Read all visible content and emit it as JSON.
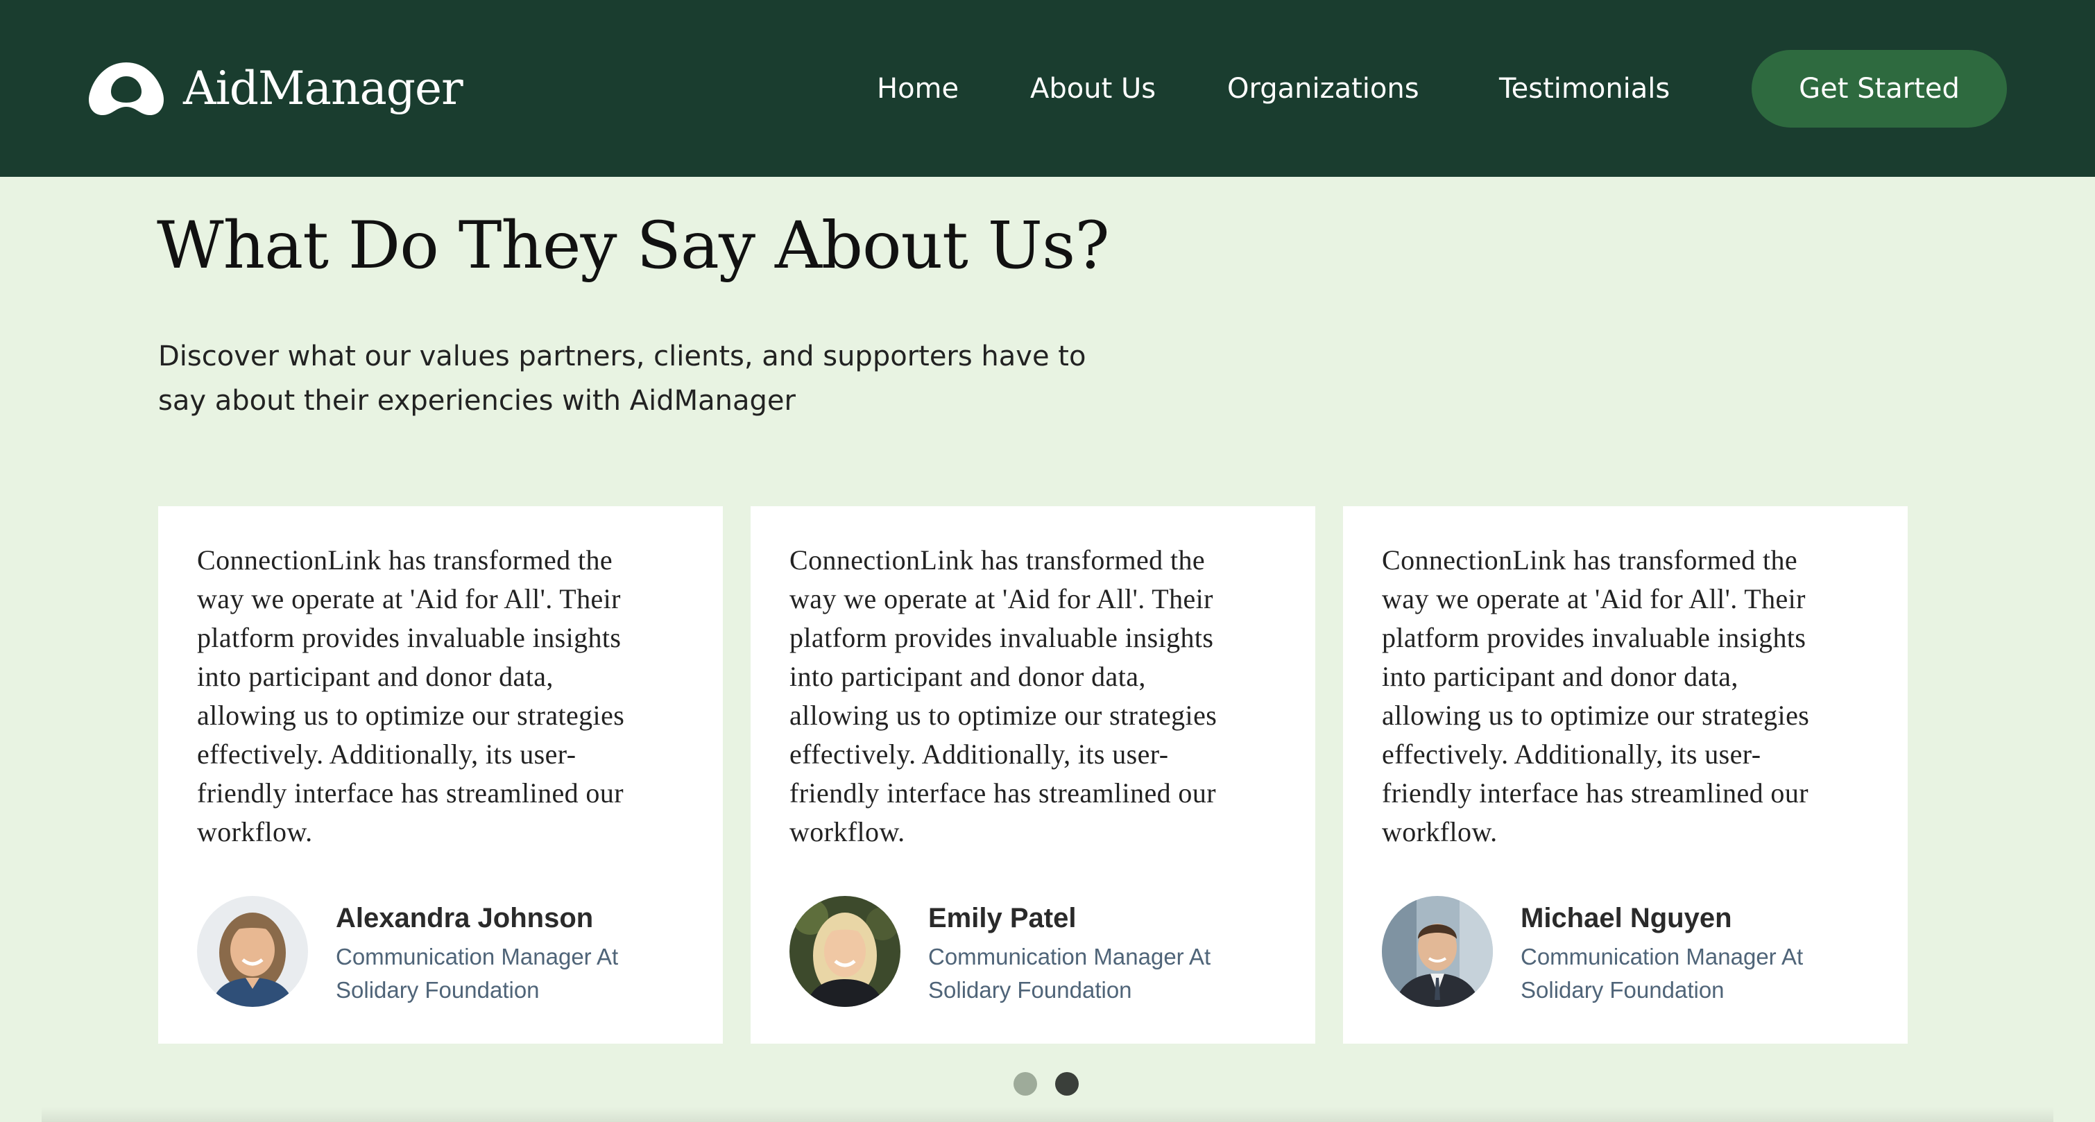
{
  "header": {
    "brand": "AidManager",
    "logo_icon": "aidmanager-logo-icon",
    "nav": [
      "Home",
      "About Us",
      "Organizations",
      "Testimonials"
    ],
    "cta_label": "Get Started"
  },
  "section": {
    "title": "What Do They Say About Us?",
    "subtitle": "Discover what our values partners, clients, and supporters have to say about their experiencies with AidManager"
  },
  "testimonials": [
    {
      "quote": "ConnectionLink has transformed the way we operate at 'Aid for All'. Their platform provides invaluable insights into participant and donor data, allowing us to optimize our strategies effectively. Additionally, its user-friendly interface has streamlined our workflow.",
      "name": "Alexandra Johnson",
      "role": "Communication Manager At Solidary Foundation"
    },
    {
      "quote": "ConnectionLink has transformed the way we operate at 'Aid for All'. Their platform provides invaluable insights into participant and donor data, allowing us to optimize our strategies effectively. Additionally, its user-friendly interface has streamlined our workflow.",
      "name": "Emily Patel",
      "role": "Communication Manager At Solidary Foundation"
    },
    {
      "quote": "ConnectionLink has transformed the way we operate at 'Aid for All'. Their platform provides invaluable insights into participant and donor data, allowing us to optimize our strategies effectively. Additionally, its user-friendly interface has streamlined our workflow.",
      "name": "Michael Nguyen",
      "role": "Communication Manager At Solidary Foundation"
    }
  ],
  "pager": {
    "pages": 2,
    "active": 2
  },
  "colors": {
    "header_bg": "#1a3d2f",
    "page_bg": "#e8f3e2",
    "cta_bg": "#2e6a3f",
    "role_text": "#4f6478"
  }
}
